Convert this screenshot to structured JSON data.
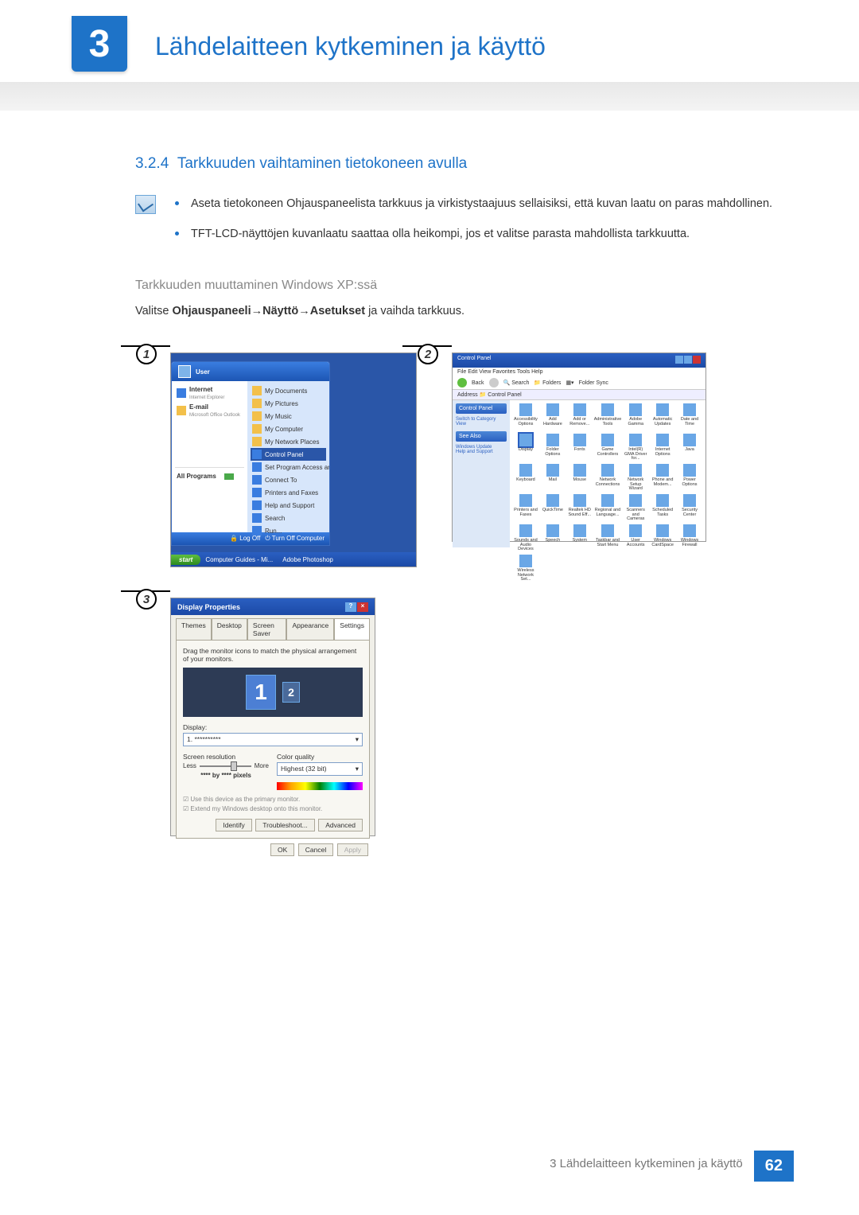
{
  "chapter": {
    "number": "3",
    "title": "Lähdelaitteen kytkeminen ja käyttö"
  },
  "section": {
    "number": "3.2.4",
    "title": "Tarkkuuden vaihtaminen tietokoneen avulla"
  },
  "bullets": [
    "Aseta tietokoneen Ohjauspaneelista tarkkuus ja virkistystaajuus sellaisiksi, että kuvan laatu on paras mahdollinen.",
    "TFT-LCD-näyttöjen kuvanlaatu saattaa olla heikompi, jos et valitse parasta mahdollista tarkkuutta."
  ],
  "sub_heading": "Tarkkuuden muuttaminen Windows XP:ssä",
  "instruction": {
    "prefix": "Valitse ",
    "b1": "Ohjauspaneeli",
    "arrow": " → ",
    "b2": "Näyttö",
    "b3": "Asetukset",
    "suffix": " ja vaihda tarkkuus."
  },
  "steps": {
    "s1": "1",
    "s2": "2",
    "s3": "3"
  },
  "xp_menu": {
    "user": "User",
    "left": [
      {
        "t": "Internet",
        "s": "Internet Explorer"
      },
      {
        "t": "E-mail",
        "s": "Microsoft Office Outlook"
      }
    ],
    "all_programs": "All Programs",
    "right": [
      "My Documents",
      "My Pictures",
      "My Music",
      "My Computer",
      "My Network Places",
      "Control Panel",
      "Set Program Access and Defaults",
      "Connect To",
      "Printers and Faxes",
      "Help and Support",
      "Search",
      "Run..."
    ],
    "right_hover_index": 5,
    "footer": {
      "logoff": "Log Off",
      "shutdown": "Turn Off Computer"
    },
    "taskbar": {
      "start": "start",
      "app1": "Computer Guides - Mi...",
      "app2": "Adobe Photoshop"
    }
  },
  "cp": {
    "title": "Control Panel",
    "menu": "File   Edit   View   Favorites   Tools   Help",
    "toolbar": {
      "back": "Back",
      "search": "Search",
      "folders": "Folders",
      "sync": "Folder Sync"
    },
    "address_label": "Address",
    "address_value": "Control Panel",
    "side": {
      "box1": "Control Panel",
      "switch": "Switch to Category View",
      "see": "See Also",
      "upd": "Windows Update",
      "help": "Help and Support"
    },
    "icons": [
      "Accessibility Options",
      "Add Hardware",
      "Add or Remove...",
      "Administrative Tools",
      "Adobe Gamma",
      "Automatic Updates",
      "Date and Time",
      "Display",
      "Folder Options",
      "Fonts",
      "Game Controllers",
      "Intel(R) GMA Driver for...",
      "Internet Options",
      "Java",
      "Keyboard",
      "Mail",
      "Mouse",
      "Network Connections",
      "Network Setup Wizard",
      "Phone and Modem...",
      "Power Options",
      "Printers and Faxes",
      "QuickTime",
      "Realtek HD Sound Eff...",
      "Regional and Language...",
      "Scanners and Cameras",
      "Scheduled Tasks",
      "Security Center",
      "Sounds and Audio Devices",
      "Speech",
      "System",
      "Taskbar and Start Menu",
      "User Accounts",
      "Windows CardSpace",
      "Windows Firewall",
      "Wireless Network Set..."
    ],
    "selected_index": 7
  },
  "dp": {
    "title": "Display Properties",
    "tabs": [
      "Themes",
      "Desktop",
      "Screen Saver",
      "Appearance",
      "Settings"
    ],
    "active_tab": 4,
    "hint": "Drag the monitor icons to match the physical arrangement of your monitors.",
    "mon1": "1",
    "mon2": "2",
    "display_label": "Display:",
    "display_value": "1. **********",
    "res_label": "Screen resolution",
    "less": "Less",
    "more": "More",
    "res_value": "**** by **** pixels",
    "cq_label": "Color quality",
    "cq_value": "Highest (32 bit)",
    "check1": "Use this device as the primary monitor.",
    "check2": "Extend my Windows desktop onto this monitor.",
    "btn_identify": "Identify",
    "btn_troubleshoot": "Troubleshoot...",
    "btn_advanced": "Advanced",
    "btn_ok": "OK",
    "btn_cancel": "Cancel",
    "btn_apply": "Apply"
  },
  "footer": {
    "text": "3 Lähdelaitteen kytkeminen ja käyttö",
    "page": "62"
  }
}
